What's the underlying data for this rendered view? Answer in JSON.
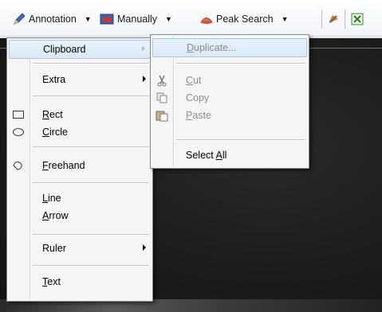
{
  "toolbar": {
    "annotation_label": "Annotation",
    "manually_label": "Manually",
    "peak_search_label": "Peak Search"
  },
  "annotation_menu": {
    "items": [
      {
        "label": "Clipboard",
        "submenu": true,
        "highlighted": true
      },
      {
        "label": "Extra",
        "submenu": true
      },
      {
        "pre": "",
        "u": "R",
        "post": "ect",
        "icon": "rectangle-icon"
      },
      {
        "pre": "",
        "u": "C",
        "post": "ircle",
        "icon": "ellipse-icon"
      },
      {
        "pre": "",
        "u": "F",
        "post": "reehand",
        "icon": "freehand-icon"
      },
      {
        "pre": "",
        "u": "L",
        "post": "ine"
      },
      {
        "pre": "",
        "u": "A",
        "post": "rrow"
      },
      {
        "label": "Ruler",
        "submenu": true
      },
      {
        "pre": "",
        "u": "T",
        "post": "ext"
      }
    ]
  },
  "clipboard_menu": {
    "items": [
      {
        "pre": "",
        "u": "D",
        "post": "uplicate...",
        "disabled": true,
        "highlighted": true
      },
      {
        "pre": "",
        "u": "C",
        "post": "ut",
        "disabled": true,
        "icon": "scissors-icon"
      },
      {
        "pre": "Copy",
        "u": "",
        "post": "",
        "disabled": true,
        "icon": "copy-icon"
      },
      {
        "pre": "",
        "u": "P",
        "post": "aste",
        "disabled": true,
        "icon": "paste-icon"
      },
      {
        "pre": "Select ",
        "u": "A",
        "post": "ll",
        "disabled": false
      }
    ]
  }
}
